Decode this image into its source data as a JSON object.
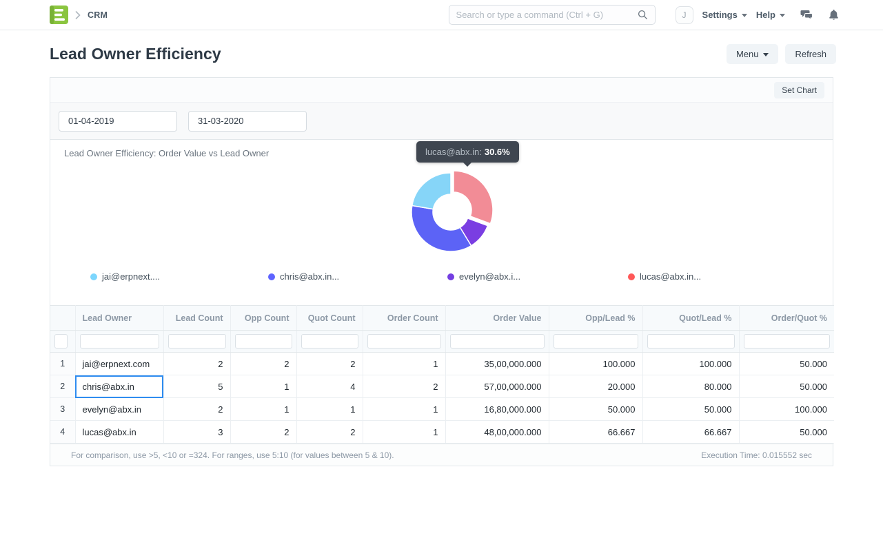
{
  "navbar": {
    "breadcrumb": "CRM",
    "search_placeholder": "Search or type a command (Ctrl + G)",
    "avatar_initial": "J",
    "settings_label": "Settings",
    "help_label": "Help"
  },
  "page": {
    "title": "Lead Owner Efficiency",
    "menu_button": "Menu",
    "refresh_button": "Refresh",
    "set_chart_button": "Set Chart"
  },
  "filters": {
    "from_date": "01-04-2019",
    "to_date": "31-03-2020"
  },
  "chart_data": {
    "type": "pie",
    "title": "Lead Owner Efficiency: Order Value vs Lead Owner",
    "labels": [
      "jai@erpnext....",
      "chris@abx.in...",
      "evelyn@abx.i...",
      "lucas@abx.in..."
    ],
    "values": [
      3500000,
      5700000,
      1680000,
      4800000
    ],
    "percentages": [
      22.3,
      36.4,
      10.7,
      30.6
    ],
    "legend_colors": [
      "#7cd6fd",
      "#5e64ff",
      "#743ee2",
      "#ff5858"
    ],
    "slice_colors": [
      "#86d5f8",
      "#5c63f6",
      "#7a3ee2",
      "#f28c96"
    ],
    "legend_position": "bottom",
    "hovered_slice": 3,
    "tooltip": {
      "label": "lucas@abx.in:",
      "value": "30.6%"
    }
  },
  "table": {
    "columns": [
      "",
      "Lead Owner",
      "Lead Count",
      "Opp Count",
      "Quot Count",
      "Order Count",
      "Order Value",
      "Opp/Lead %",
      "Quot/Lead %",
      "Order/Quot %"
    ],
    "rows": [
      {
        "index": "1",
        "cells": [
          "jai@erpnext.com",
          "2",
          "2",
          "2",
          "1",
          "35,00,000.000",
          "100.000",
          "100.000",
          "50.000"
        ]
      },
      {
        "index": "2",
        "cells": [
          "chris@abx.in",
          "5",
          "1",
          "4",
          "2",
          "57,00,000.000",
          "20.000",
          "80.000",
          "50.000"
        ]
      },
      {
        "index": "3",
        "cells": [
          "evelyn@abx.in",
          "2",
          "1",
          "1",
          "1",
          "16,80,000.000",
          "50.000",
          "50.000",
          "100.000"
        ]
      },
      {
        "index": "4",
        "cells": [
          "lucas@abx.in",
          "3",
          "2",
          "2",
          "1",
          "48,00,000.000",
          "66.667",
          "66.667",
          "50.000"
        ]
      }
    ],
    "focused_cell": {
      "row": 1,
      "col": 0
    },
    "footer_hint": "For comparison, use >5, <10 or =324. For ranges, use 5:10 (for values between 5 & 10).",
    "execution_time": "Execution Time: 0.015552 sec"
  }
}
